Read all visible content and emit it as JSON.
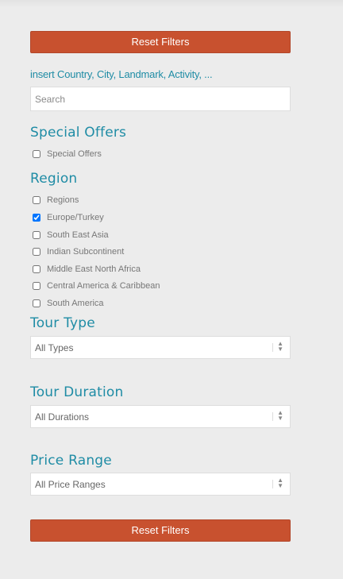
{
  "buttons": {
    "reset_top": "Reset Filters",
    "reset_bottom": "Reset Filters"
  },
  "search": {
    "hint": "insert Country, City, Landmark, Activity, ...",
    "placeholder": "Search"
  },
  "special_offers": {
    "title": "Special Offers",
    "items": [
      {
        "label": "Special Offers",
        "checked": false
      }
    ]
  },
  "region": {
    "title": "Region",
    "items": [
      {
        "label": "Regions",
        "checked": false
      },
      {
        "label": "Europe/Turkey",
        "checked": true
      },
      {
        "label": "South East Asia",
        "checked": false
      },
      {
        "label": "Indian Subcontinent",
        "checked": false
      },
      {
        "label": "Middle East North Africa",
        "checked": false
      },
      {
        "label": "Central America & Caribbean",
        "checked": false
      },
      {
        "label": "South America",
        "checked": false
      }
    ]
  },
  "tour_type": {
    "title": "Tour Type",
    "selected": "All Types"
  },
  "tour_duration": {
    "title": "Tour Duration",
    "selected": "All Durations"
  },
  "price_range": {
    "title": "Price Range",
    "selected": "All Price Ranges"
  },
  "colors": {
    "accent": "#1f8ca5",
    "button": "#c8512f",
    "background": "#ececec"
  }
}
